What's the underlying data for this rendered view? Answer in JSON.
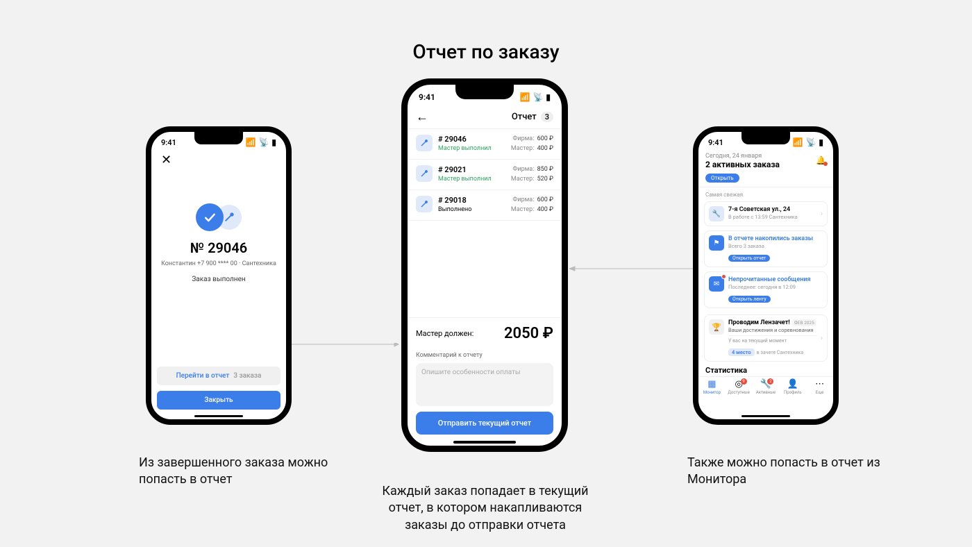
{
  "page_title": "Отчет по заказу",
  "statusbar": {
    "time": "9:41"
  },
  "phone1": {
    "order_no": "№ 29046",
    "sub": "Константин  +7 900 **** 00  ·  Сантехника",
    "done": "Заказ выполнен",
    "btn1": "Перейти в отчет",
    "btn1_count": "3 заказа",
    "btn2": "Закрыть"
  },
  "phone2": {
    "title": "Отчет",
    "count": "3",
    "rows": [
      {
        "num": "# 29046",
        "status": "Мастер выполнил",
        "status_class": "green",
        "firm": "600 ₽",
        "master": "400 ₽"
      },
      {
        "num": "# 29021",
        "status": "Мастер выполнил",
        "status_class": "green",
        "firm": "850 ₽",
        "master": "520 ₽"
      },
      {
        "num": "# 29018",
        "status": "Выполнено",
        "status_class": "",
        "firm": "600 ₽",
        "master": "400 ₽"
      }
    ],
    "firm_lbl": "Фирма:",
    "master_lbl": "Мастер:",
    "total_lbl": "Мастер должен:",
    "total_val": "2050 ₽",
    "comment_lbl": "Комментарий к отчету",
    "comment_ph": "Опишите особенности оплаты",
    "send": "Отправить текущий отчет"
  },
  "phone3": {
    "date": "Сегодня, 24 января",
    "active": "2 активных заказа",
    "open": "Открыть",
    "section": "Самая свежая",
    "card1": {
      "title": "7-я Советская ул., 24",
      "sub": "В работе с 13:59   Сантехника"
    },
    "card2": {
      "title": "В отчете накопились заказы",
      "sub": "Всего 3 заказа",
      "pill": "Открыть отчет"
    },
    "card3": {
      "title": "Непрочитанные сообщения",
      "sub": "Последнее: сегодня в 12:09",
      "pill": "Открыть ленту"
    },
    "promo": {
      "title": "Проводим Лензачет!",
      "date": "ФЕВ 2025",
      "sub": "Ваши достижения и соревнования",
      "moment": "У вас на текущий момент",
      "place": "4 место",
      "place_sub": "в зачете Сантехника"
    },
    "stat": "Статистика",
    "tabs": [
      {
        "label": "Монитор",
        "icon": "▦"
      },
      {
        "label": "Доступные",
        "icon": "◎",
        "badge": "9"
      },
      {
        "label": "Активные",
        "icon": "🔧",
        "badge": "2"
      },
      {
        "label": "Профиль",
        "icon": "👤"
      },
      {
        "label": "Еще",
        "icon": "⋯"
      }
    ]
  },
  "captions": {
    "c1": "Из завершенного заказа можно попасть в отчет",
    "c2": "Каждый заказ попадает в текущий отчет, в котором накапливаются заказы до отправки отчета",
    "c3": "Также можно попасть в отчет из Монитора"
  }
}
